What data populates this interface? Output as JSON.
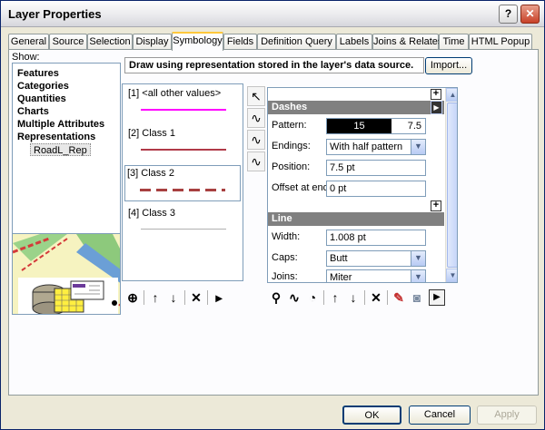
{
  "window": {
    "title": "Layer Properties"
  },
  "tabs": [
    {
      "label": "General"
    },
    {
      "label": "Source"
    },
    {
      "label": "Selection"
    },
    {
      "label": "Display"
    },
    {
      "label": "Symbology"
    },
    {
      "label": "Fields"
    },
    {
      "label": "Definition Query"
    },
    {
      "label": "Labels"
    },
    {
      "label": "Joins & Relates"
    },
    {
      "label": "Time"
    },
    {
      "label": "HTML Popup"
    }
  ],
  "active_tab": "Symbology",
  "show": {
    "label": "Show:",
    "items": [
      "Features",
      "Categories",
      "Quantities",
      "Charts",
      "Multiple Attributes",
      "Representations"
    ],
    "sub_item": "RoadL_Rep"
  },
  "description": "Draw using representation stored in the layer's data source.",
  "import_button": "Import...",
  "values": [
    {
      "label": "[1] <all other values>",
      "color": "#ff00ff"
    },
    {
      "label": "[2] Class 1",
      "color": "#b03a48"
    },
    {
      "label": "[3] Class 2",
      "color": "#a84040"
    },
    {
      "label": "[4] Class 3",
      "color": "#b0b0b0"
    }
  ],
  "dashes": {
    "header": "Dashes",
    "pattern_label": "Pattern:",
    "pattern_values": [
      "15",
      "7.5"
    ],
    "endings_label": "Endings:",
    "endings_value": "With half pattern",
    "position_label": "Position:",
    "position_value": "7.5 pt",
    "offset_label": "Offset at end:",
    "offset_value": "0 pt"
  },
  "line": {
    "header": "Line",
    "width_label": "Width:",
    "width_value": "1.008 pt",
    "caps_label": "Caps:",
    "caps_value": "Butt",
    "joins_label": "Joins:",
    "joins_value": "Miter"
  },
  "buttons": {
    "ok": "OK",
    "cancel": "Cancel",
    "apply": "Apply"
  }
}
